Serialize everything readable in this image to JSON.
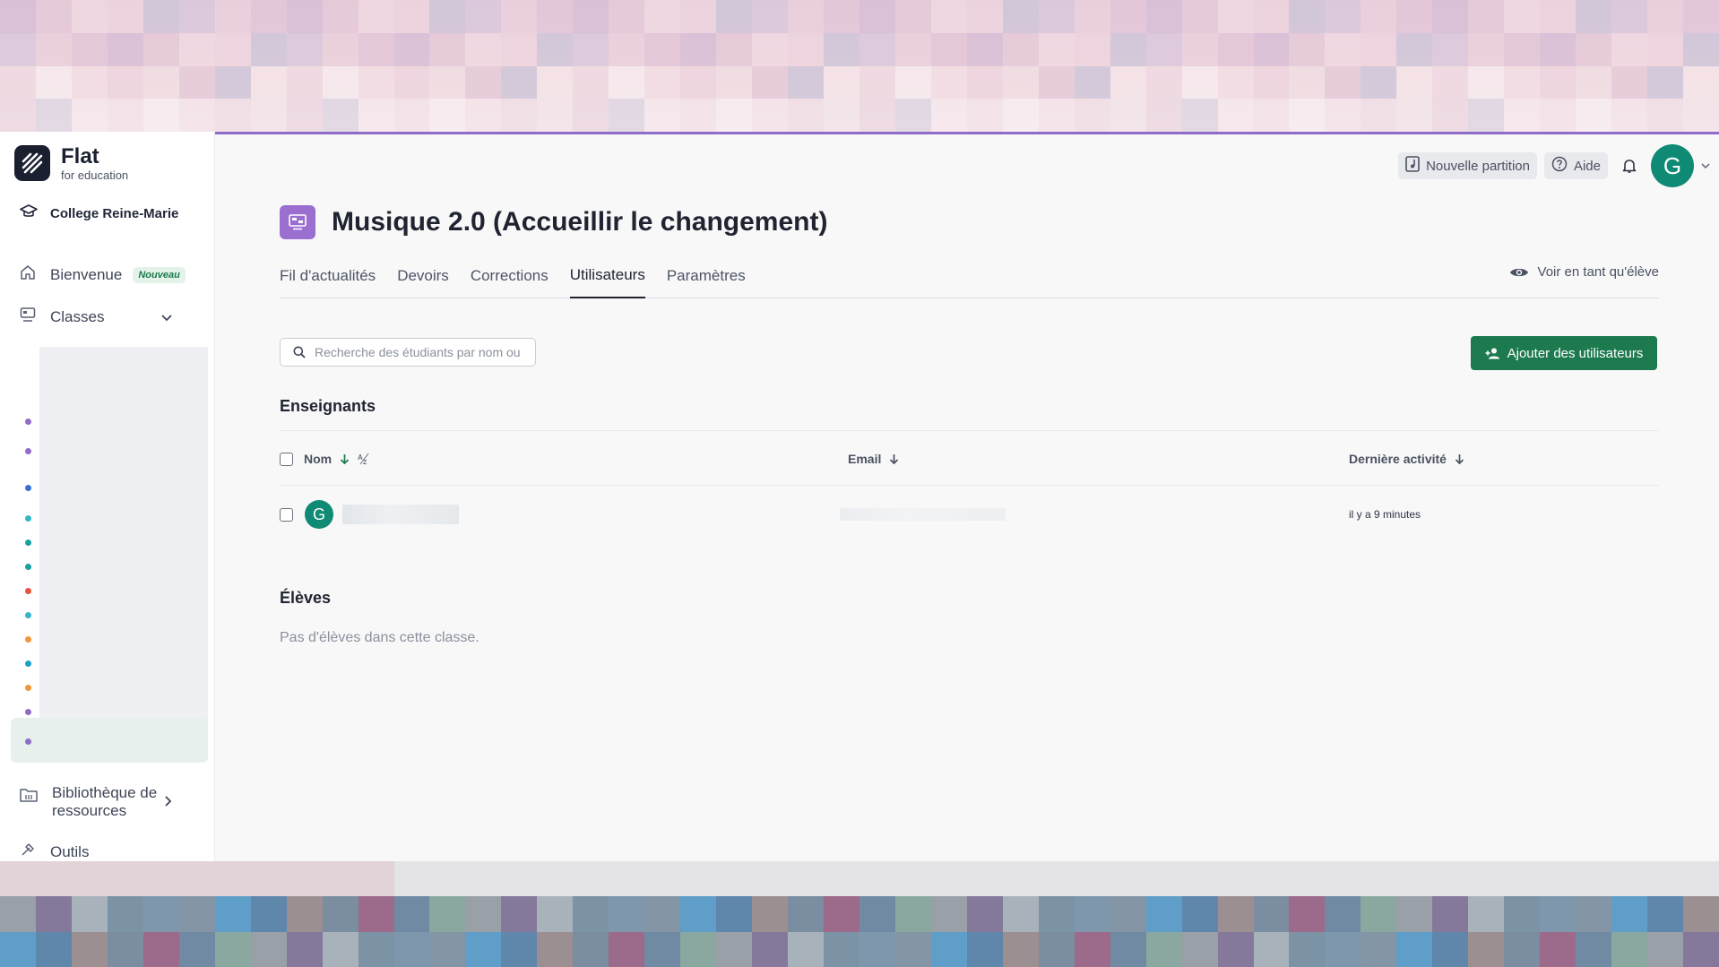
{
  "app": {
    "logo_title": "Flat",
    "logo_subtitle": "for education",
    "school_name": "College Reine-Marie",
    "brand_color": "#1b2030",
    "accent_color": "#1d7a4f"
  },
  "sidebar": {
    "items": [
      {
        "label": "Bienvenue",
        "badge": "Nouveau",
        "icon": "home-icon"
      },
      {
        "label": "Classes",
        "icon": "classes-icon"
      },
      {
        "label": "Bibliothèque de ressources",
        "icon": "folder-icon"
      },
      {
        "label": "Outils",
        "icon": "tools-icon"
      }
    ],
    "class_dot_colors": [
      "#8e6cc7",
      "#8e6cc7",
      "#3a6fd8",
      "#35b5c9",
      "#1aa0a0",
      "#1aa0a0",
      "#e5533d",
      "#35b5c9",
      "#f0963a",
      "#1aa0c9",
      "#f0963a",
      "#8e6cc7",
      "#8e6cc7"
    ]
  },
  "header": {
    "new_score_label": "Nouvelle partition",
    "help_label": "Aide",
    "avatar_letter": "G"
  },
  "page": {
    "title": "Musique 2.0 (Accueillir le changement)",
    "class_color": "#9a6fd0",
    "tabs": [
      {
        "label": "Fil d'actualités"
      },
      {
        "label": "Devoirs"
      },
      {
        "label": "Corrections"
      },
      {
        "label": "Utilisateurs",
        "active": true
      },
      {
        "label": "Paramètres"
      }
    ],
    "view_as_label": "Voir en tant qu'élève"
  },
  "users": {
    "search_placeholder": "Recherche des étudiants par nom ou",
    "add_button_label": "Ajouter des utilisateurs",
    "teachers_title": "Enseignants",
    "columns": {
      "name": "Nom",
      "email": "Email",
      "last_activity": "Dernière activité"
    },
    "teachers": [
      {
        "avatar_letter": "G",
        "last_activity": "il y a 9 minutes"
      }
    ],
    "students_title": "Élèves",
    "students_empty": "Pas d'élèves dans cette classe."
  }
}
